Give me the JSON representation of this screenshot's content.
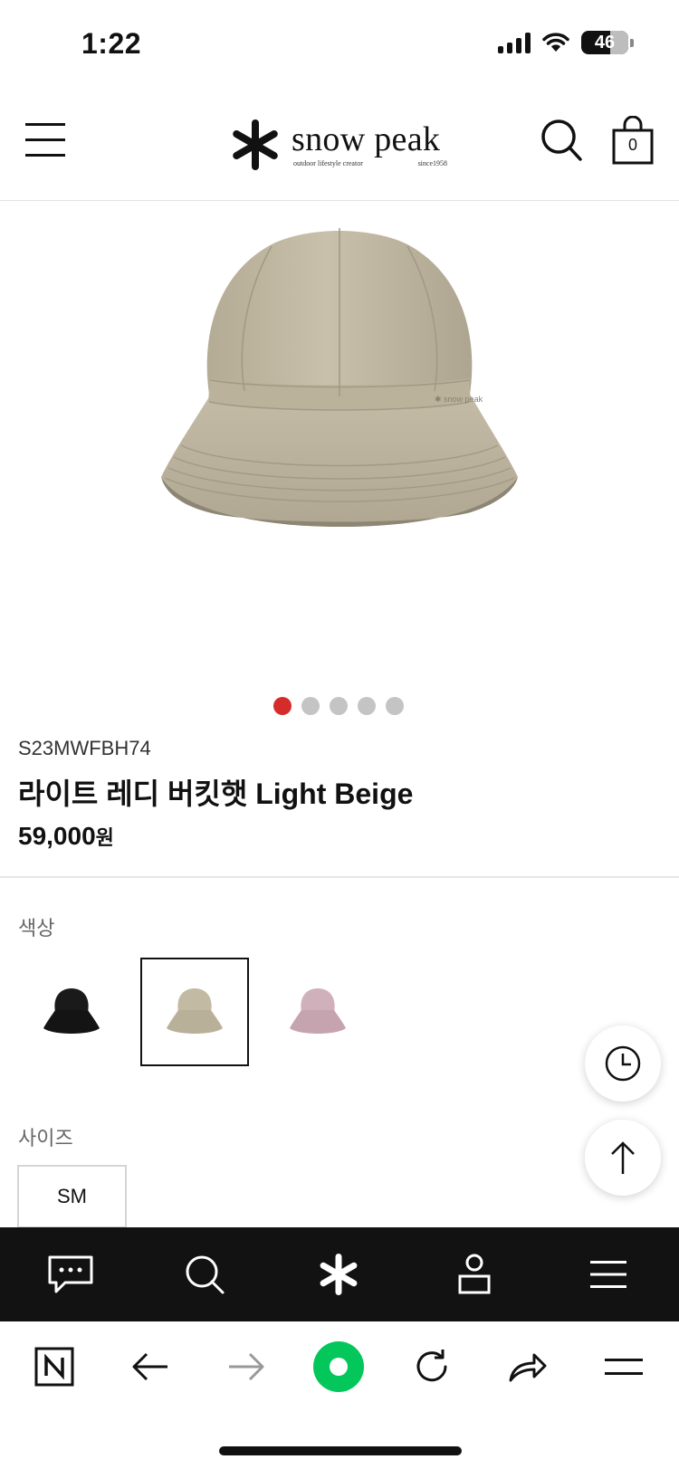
{
  "status_bar": {
    "time": "1:22",
    "battery": "46"
  },
  "header": {
    "brand_name": "snow peak",
    "brand_tagline": "outdoor lifestyle creator",
    "brand_since": "since1958",
    "cart_count": "0"
  },
  "gallery": {
    "total": 5,
    "active": 0
  },
  "product": {
    "sku": "S23MWFBH74",
    "title": "라이트 레디 버킷햇 Light Beige",
    "price": "59,000",
    "currency": "원"
  },
  "options": {
    "color_label": "색상",
    "colors": [
      {
        "name": "black",
        "hex": "#1a1a1a",
        "selected": false
      },
      {
        "name": "light-beige",
        "hex": "#bdb39c",
        "selected": true
      },
      {
        "name": "pink",
        "hex": "#c9a7b4",
        "selected": false
      }
    ],
    "size_label": "사이즈",
    "sizes": [
      "SM"
    ]
  },
  "colors": {
    "accent_red": "#d52b2b",
    "nav_bg": "#121212",
    "naver_green": "#03c75a"
  },
  "icons": {
    "site_nav": [
      "chat-icon",
      "search-icon",
      "snowpeak-logo-icon",
      "user-icon",
      "menu-icon"
    ],
    "browser": [
      "naver-n-icon",
      "back-arrow-icon",
      "forward-arrow-icon",
      "naver-green-button",
      "reload-icon",
      "share-icon",
      "menu-icon"
    ]
  }
}
